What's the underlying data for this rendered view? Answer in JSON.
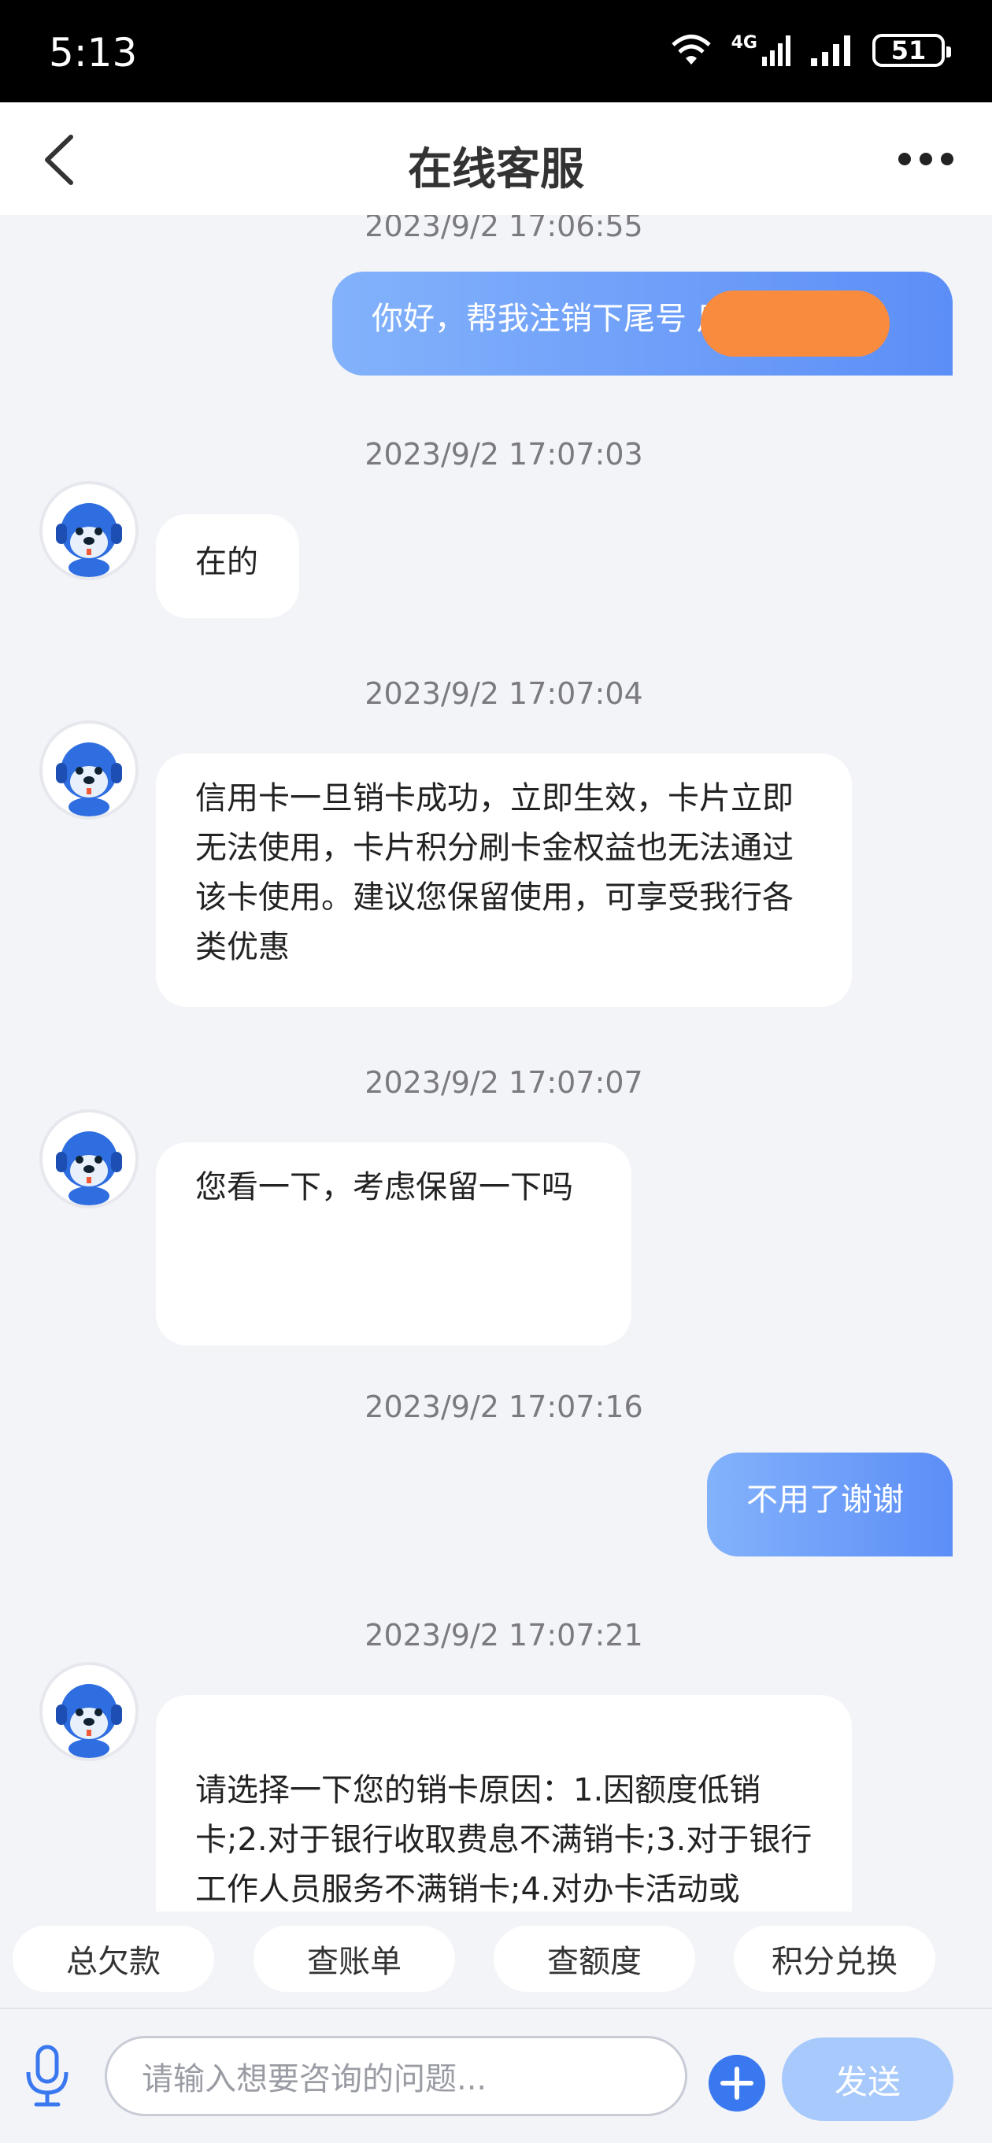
{
  "status_bar": {
    "time": "5:13",
    "battery": "51",
    "network_label": "4G",
    "icons": [
      "wifi-icon",
      "cellular-signal-icon",
      "battery-icon"
    ]
  },
  "header": {
    "title": "在线客服",
    "back_icon": "chevron-left-icon",
    "more_icon": "more-dots-icon"
  },
  "messages": [
    {
      "time": "2023/9/2 17:06:55",
      "side": "out",
      "text": "你好，帮我注销下尾号 用卡",
      "redacted": true
    },
    {
      "time": "2023/9/2 17:07:03",
      "side": "in",
      "text": "在的"
    },
    {
      "time": "2023/9/2 17:07:04",
      "side": "in",
      "text": "信用卡一旦销卡成功，立即生效，卡片立即无法使用，卡片积分刷卡金权益也无法通过该卡使用。建议您保留使用，可享受我行各类优惠"
    },
    {
      "time": "2023/9/2 17:07:07",
      "side": "in",
      "text": "您看一下，考虑保留一下吗"
    },
    {
      "time": "2023/9/2 17:07:16",
      "side": "out",
      "text": "不用了谢谢"
    },
    {
      "time": "2023/9/2 17:07:21",
      "side": "in",
      "text": "请选择一下您的销卡原因：1.因额度低销卡;2.对于银行收取费息不满销卡;3.对于银行工作人员服务不满销卡;4.对办卡活动或"
    }
  ],
  "quick_actions": [
    "总欠款",
    "查账单",
    "查额度",
    "积分兑换"
  ],
  "input": {
    "placeholder": "请输入想要咨询的问题...",
    "send_label": "发送"
  },
  "colors": {
    "accent": "#3a78f0",
    "bubble_out_start": "#83b2fb",
    "bubble_out_end": "#5c8ef7",
    "background": "#f3f4f8",
    "redaction": "#f98b3f"
  }
}
